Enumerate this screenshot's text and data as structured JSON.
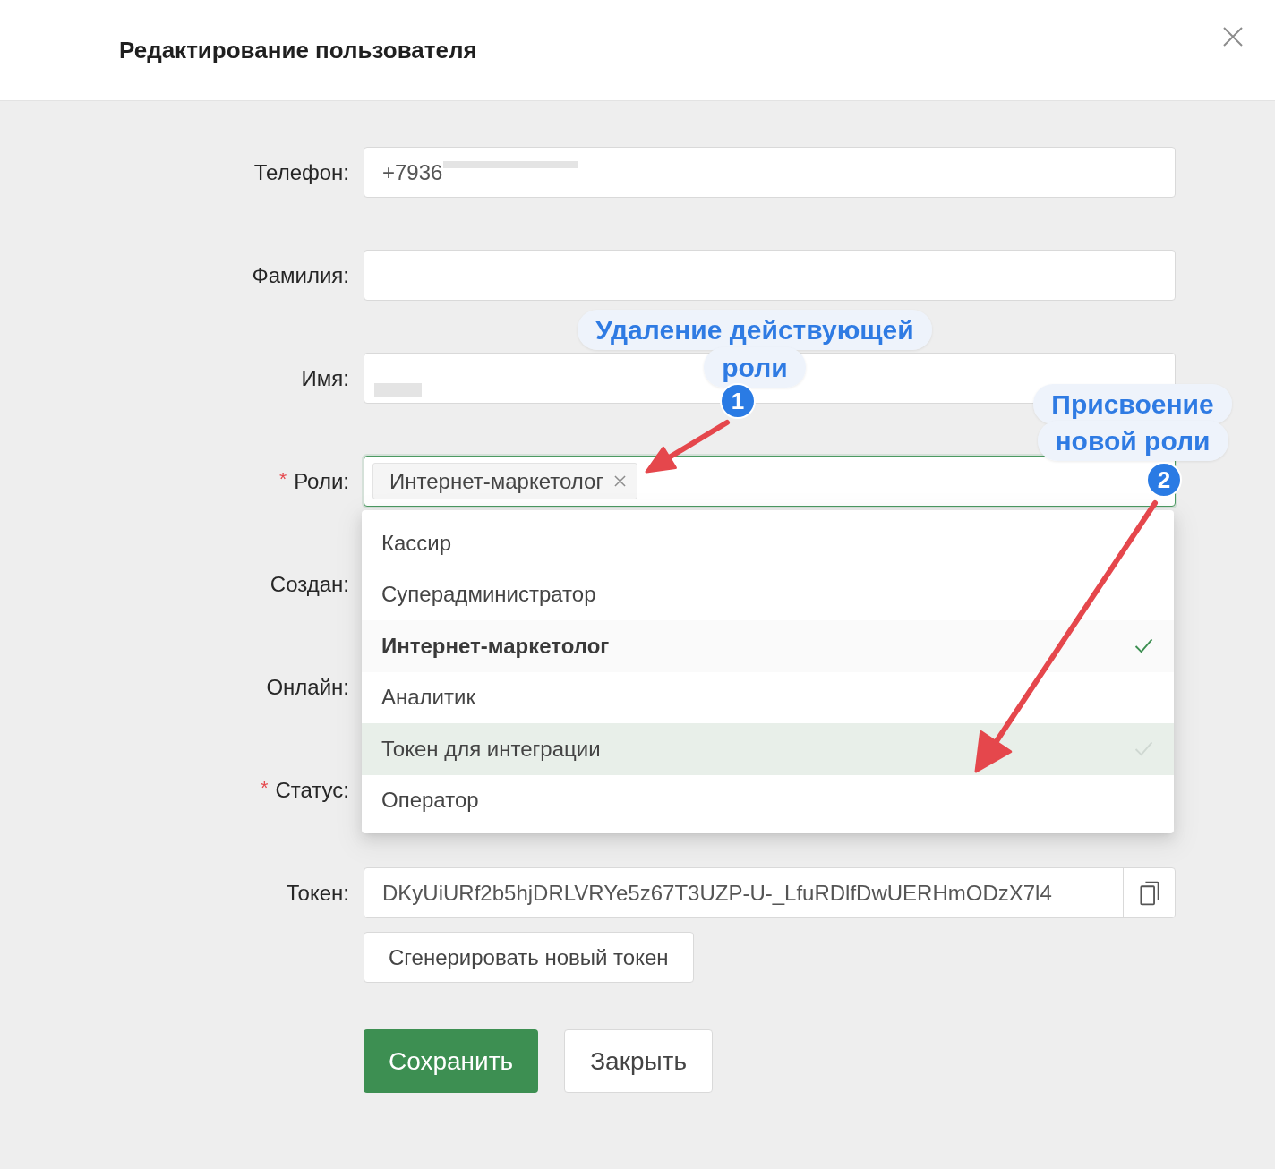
{
  "dialog": {
    "title": "Редактирование пользователя"
  },
  "form": {
    "fields": [
      {
        "kind": "text",
        "label": "Телефон:",
        "value": "+7936",
        "redacted": true
      },
      {
        "kind": "text",
        "label": "Фамилия:"
      },
      {
        "kind": "text",
        "label": "Имя:",
        "redacted": true
      },
      {
        "kind": "tags",
        "label": "Роли:",
        "required_mark": "*",
        "focused": true,
        "tags": [
          {
            "label": "Интернет-маркетолог"
          }
        ],
        "dropdown": {
          "options": [
            {
              "label": "Кассир",
              "selected": false,
              "highlighted": false
            },
            {
              "label": "Суперадминистратор",
              "selected": false,
              "highlighted": false
            },
            {
              "label": "Интернет-маркетолог",
              "selected": true,
              "highlighted": false
            },
            {
              "label": "Аналитик",
              "selected": false,
              "highlighted": false
            },
            {
              "label": "Токен для интеграции",
              "selected": false,
              "highlighted": true
            },
            {
              "label": "Оператор",
              "selected": false,
              "highlighted": false
            }
          ]
        }
      },
      {
        "kind": "covered",
        "label": "Создан:"
      },
      {
        "kind": "covered",
        "label": "Онлайн:"
      },
      {
        "kind": "covered",
        "label": "Статус:",
        "required_mark": "*"
      },
      {
        "kind": "token",
        "label": "Токен:",
        "value": "DKyUiURf2b5hjDRLVRYe5z67T3UZP-U-_LfuRDlfDwUERHmODzX7l4",
        "button": "Сгенерировать новый токен"
      }
    ]
  },
  "actions": [
    {
      "kind": "primary",
      "label": "Сохранить"
    },
    {
      "kind": "default",
      "label": "Закрыть"
    }
  ],
  "annotations": [
    {
      "number": "1",
      "text": "Удаление действующей роли"
    },
    {
      "number": "2",
      "text": "Присвоение новой роли"
    }
  ]
}
